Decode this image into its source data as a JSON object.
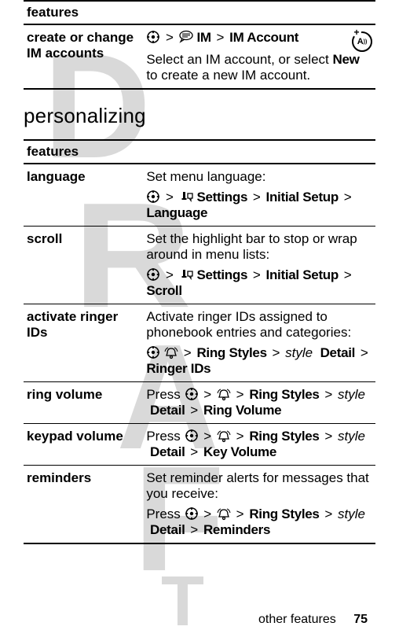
{
  "table1": {
    "header": "features",
    "row": {
      "label": "create or change IM accounts",
      "path_im": "IM",
      "path_imacct": "IM Account",
      "desc1": "Select an IM account, or select ",
      "desc_new": "New",
      "desc2": " to create a new IM account."
    }
  },
  "section_title": "personalizing",
  "table2": {
    "header": "features",
    "rows": {
      "language": {
        "label": "language",
        "desc": "Set menu language:",
        "p_settings": "Settings",
        "p_initial": "Initial Setup",
        "p_lang": "Language"
      },
      "scroll": {
        "label": "scroll",
        "desc": "Set the highlight bar to stop or wrap around in menu lists:",
        "p_settings": "Settings",
        "p_initial": "Initial Setup",
        "p_scroll": "Scroll"
      },
      "ringerids": {
        "label": "activate ringer IDs",
        "desc": "Activate ringer IDs assigned to phonebook entries and categories:",
        "p_ring": "Ring Styles",
        "p_style": "style",
        "p_detail": "Detail",
        "p_rids": "Ringer IDs"
      },
      "ringvol": {
        "label": "ring volume",
        "p_press": "Press ",
        "p_ring": "Ring Styles",
        "p_style": "style",
        "p_detail": "Detail",
        "p_rv": "Ring Volume"
      },
      "keyvol": {
        "label": "keypad volume",
        "p_press": "Press ",
        "p_ring": "Ring Styles",
        "p_style": "style",
        "p_detail": "Detail",
        "p_kv": "Key Volume"
      },
      "reminders": {
        "label": "reminders",
        "desc": "Set reminder alerts for messages that you receive:",
        "p_press": "Press ",
        "p_ring": "Ring Styles",
        "p_style": "style",
        "p_detail": "Detail",
        "p_rem": "Reminders"
      }
    }
  },
  "footer": {
    "text": "other features",
    "page": "75"
  },
  "glyphs": {
    "gt": ">"
  }
}
